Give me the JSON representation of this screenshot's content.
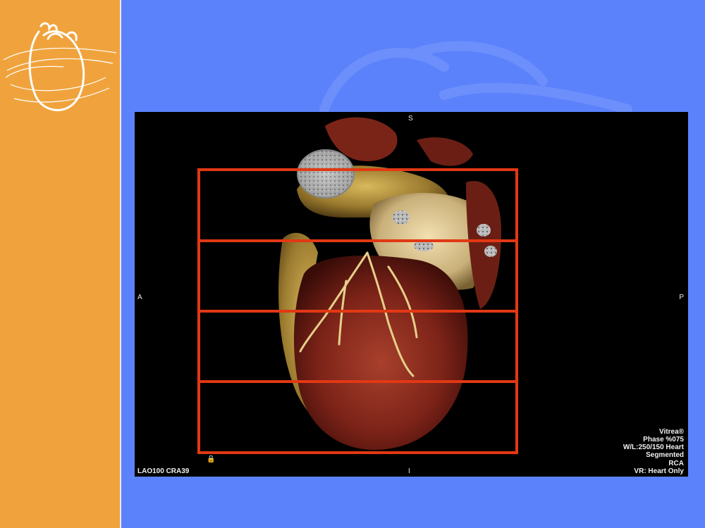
{
  "orientation": {
    "top": "S",
    "bottom": "I",
    "left": "A",
    "right": "P"
  },
  "angle": "LAO100 CRA39",
  "info_lines": [
    "Vitrea®",
    "Phase %075",
    "W/L:250/150 Heart",
    "Segmented",
    "RCA",
    "VR: Heart Only"
  ],
  "lock_glyph": "🔒",
  "bands": [
    {
      "label": "band-1"
    },
    {
      "label": "band-2"
    },
    {
      "label": "band-3"
    },
    {
      "label": "band-4"
    }
  ],
  "colors": {
    "background": "#5b82fb",
    "left_bar": "#f0a33c",
    "band_outline": "#e23814",
    "viewer_bg": "#000000"
  }
}
